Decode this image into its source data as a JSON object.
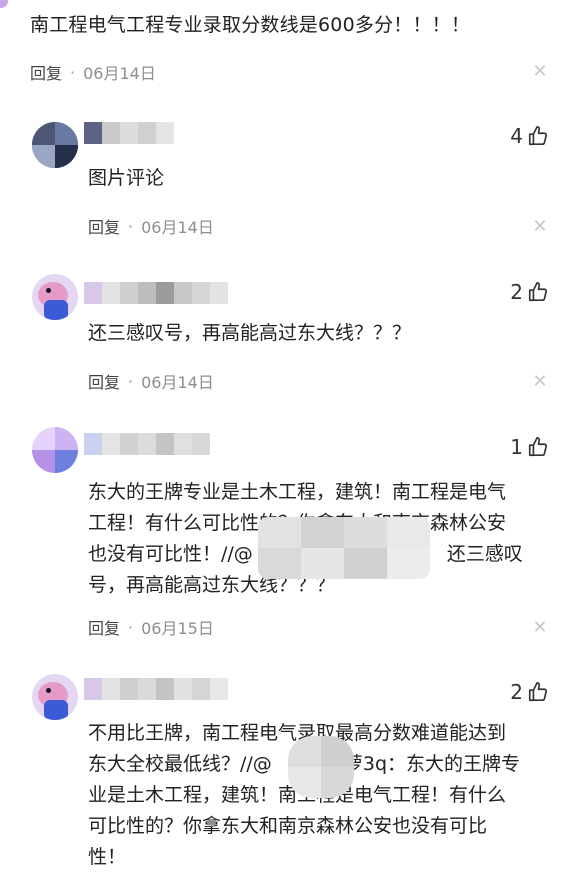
{
  "top_comment": {
    "text": "南工程电气工程专业录取分数线是600多分！！！！",
    "reply_label": "回复",
    "separator": "·",
    "date": "06月14日"
  },
  "comments": [
    {
      "text": "图片评论",
      "likes": "4",
      "reply_label": "回复",
      "separator": "·",
      "date": "06月14日"
    },
    {
      "text": "还三感叹号，再高能高过东大线？？？",
      "likes": "2",
      "reply_label": "回复",
      "separator": "·",
      "date": "06月14日"
    },
    {
      "text_line1": "东大的王牌专业是土木工程，建筑！南工程是电气",
      "text_line2": "工程！有什么可比性的？你拿东大和南京森林公安",
      "text_line3a": "也没有可比性！//@",
      "text_line3b": "还三感叹",
      "text_line4": "号，再高能高过东大线？？？",
      "likes": "1",
      "reply_label": "回复",
      "separator": "·",
      "date": "06月15日"
    },
    {
      "text_line1": "不用比王牌，南工程电气录取最高分数难道能达到",
      "text_line2a": "东大全校最低线？//@",
      "text_line2b": "萝3q：东大的王牌专",
      "text_line3": "业是土木工程，建筑！南工程是电气工程！有什么",
      "text_line4": "可比性的？你拿东大和南京森林公安也没有可比",
      "text_line5": "性！",
      "likes": "2"
    }
  ],
  "icons": {
    "like": "thumbs-up-icon",
    "close": "close-icon"
  },
  "colors": {
    "text": "#222222",
    "meta": "#8e8e8e",
    "close": "#c8c8c8"
  }
}
